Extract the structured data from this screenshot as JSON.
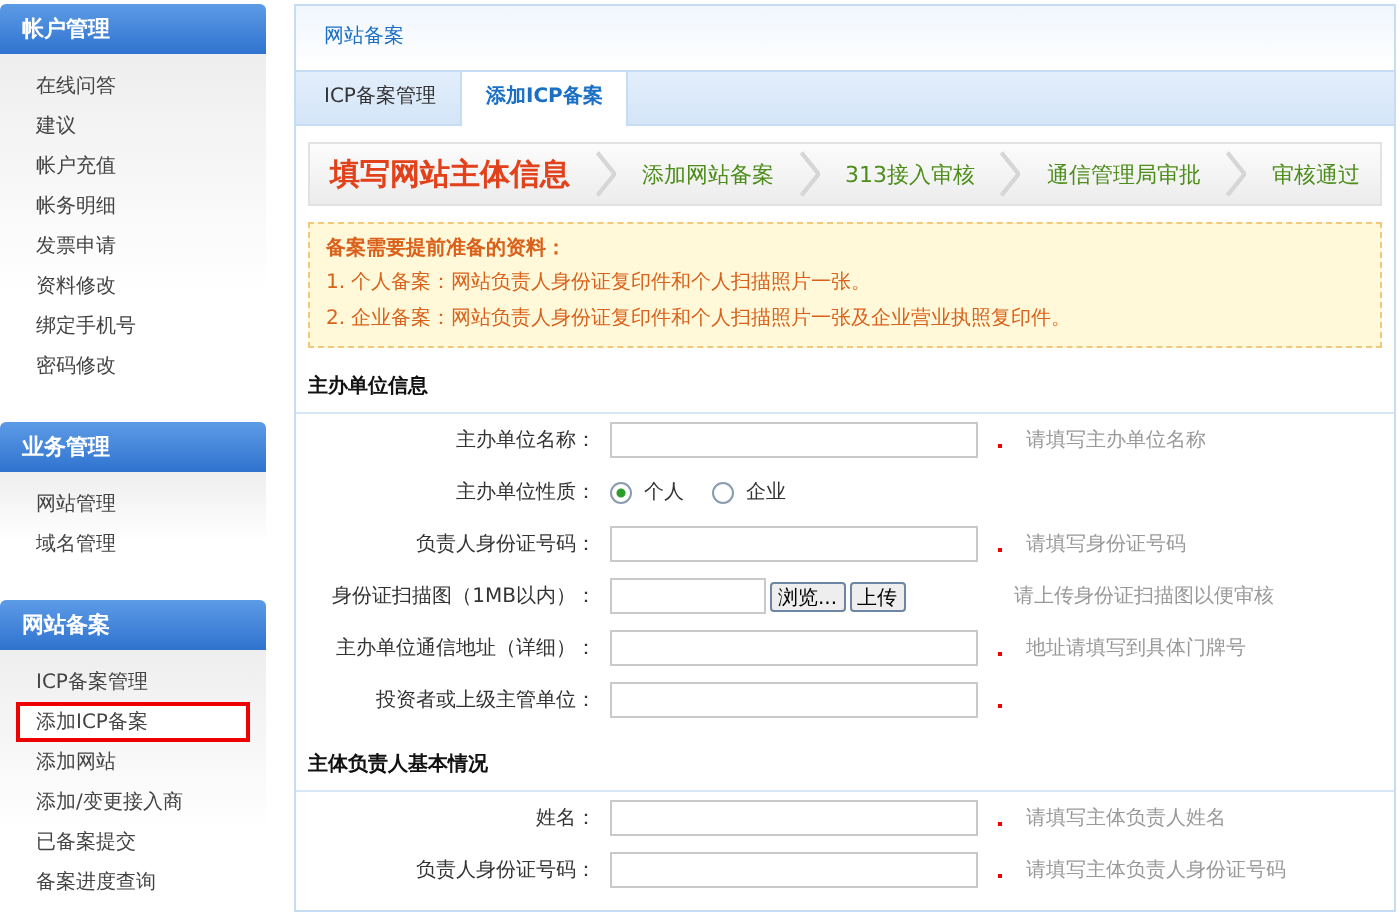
{
  "sidebar": {
    "sections": [
      {
        "title": "帐户管理",
        "items": [
          {
            "label": "在线问答",
            "selected": false
          },
          {
            "label": "建议",
            "selected": false
          },
          {
            "label": "帐户充值",
            "selected": false
          },
          {
            "label": "帐务明细",
            "selected": false
          },
          {
            "label": "发票申请",
            "selected": false
          },
          {
            "label": "资料修改",
            "selected": false
          },
          {
            "label": "绑定手机号",
            "selected": false
          },
          {
            "label": "密码修改",
            "selected": false
          }
        ]
      },
      {
        "title": "业务管理",
        "items": [
          {
            "label": "网站管理",
            "selected": false
          },
          {
            "label": "域名管理",
            "selected": false
          }
        ]
      },
      {
        "title": "网站备案",
        "items": [
          {
            "label": "ICP备案管理",
            "selected": false
          },
          {
            "label": "添加ICP备案",
            "selected": true
          },
          {
            "label": "添加网站",
            "selected": false
          },
          {
            "label": "添加/变更接入商",
            "selected": false
          },
          {
            "label": "已备案提交",
            "selected": false
          },
          {
            "label": "备案进度查询",
            "selected": false
          }
        ]
      }
    ]
  },
  "panel": {
    "title": "网站备案",
    "tabs": [
      {
        "label": "ICP备案管理",
        "selected": false
      },
      {
        "label": "添加ICP备案",
        "selected": true
      }
    ],
    "steps": [
      {
        "label": "填写网站主体信息",
        "selected": true
      },
      {
        "label": "添加网站备案",
        "selected": false
      },
      {
        "label": "313接入审核",
        "selected": false
      },
      {
        "label": "通信管理局审批",
        "selected": false
      },
      {
        "label": "审核通过",
        "selected": false
      }
    ],
    "notice": {
      "title": "备案需要提前准备的资料：",
      "lines": [
        "1. 个人备案：网站负责人身份证复印件和个人扫描照片一张。",
        "2. 企业备案：网站负责人身份证复印件和个人扫描照片一张及企业营业执照复印件。"
      ]
    },
    "sections": [
      {
        "title": "主办单位信息",
        "fields": [
          {
            "kind": "text",
            "label": "主办单位名称：",
            "required": true,
            "hint": "请填写主办单位名称"
          },
          {
            "kind": "radio",
            "label": "主办单位性质：",
            "options": [
              {
                "label": "个人",
                "selected": true
              },
              {
                "label": "企业",
                "selected": false
              }
            ]
          },
          {
            "kind": "text",
            "label": "负责人身份证号码：",
            "required": true,
            "hint": "请填写身份证号码"
          },
          {
            "kind": "file",
            "label": "身份证扫描图（1MB以内）：",
            "browse": "浏览...",
            "upload": "上传",
            "hint": "请上传身份证扫描图以便审核"
          },
          {
            "kind": "text",
            "label": "主办单位通信地址（详细）：",
            "required": true,
            "hint": "地址请填写到具体门牌号"
          },
          {
            "kind": "text",
            "label": "投资者或上级主管单位：",
            "required": true
          }
        ]
      },
      {
        "title": "主体负责人基本情况",
        "fields": [
          {
            "kind": "text",
            "label": "姓名：",
            "required": true,
            "hint": "请填写主体负责人姓名"
          },
          {
            "kind": "text",
            "label": "负责人身份证号码：",
            "required": true,
            "hint": "请填写主体负责人身份证号码"
          }
        ]
      }
    ]
  }
}
